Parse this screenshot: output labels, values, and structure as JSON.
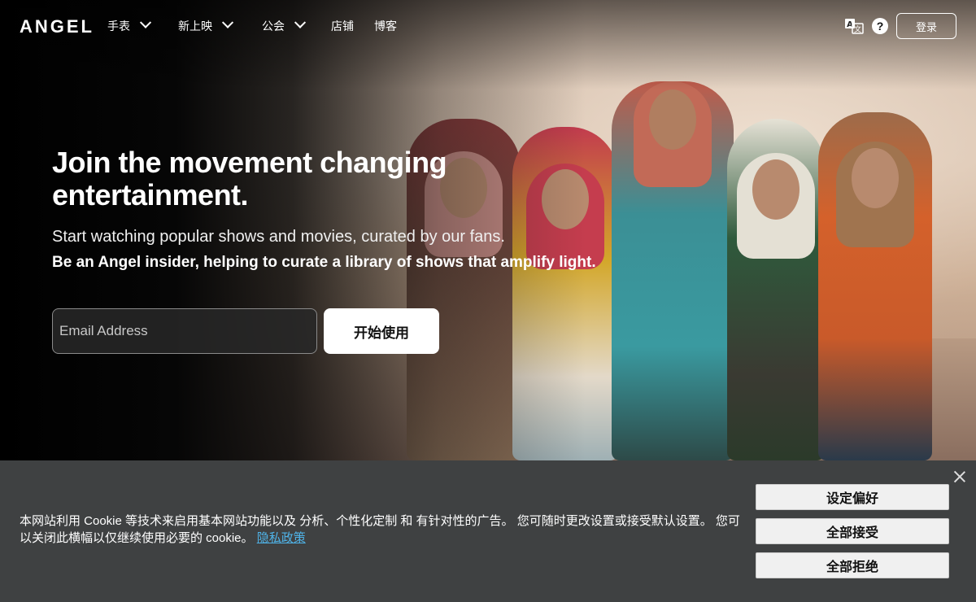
{
  "nav": {
    "logo": "ANGEL",
    "items": [
      {
        "label": "手表",
        "dropdown": true
      },
      {
        "label": "新上映",
        "dropdown": true
      },
      {
        "label": "公会",
        "dropdown": true
      },
      {
        "label": "店铺",
        "dropdown": false
      },
      {
        "label": "博客",
        "dropdown": false
      }
    ],
    "help_glyph": "?",
    "login_label": "登录"
  },
  "hero": {
    "headline": "Join the movement changing entertainment.",
    "subtitle": "Start watching popular shows and movies, curated by our fans.",
    "subtitle_bold": "Be an Angel insider, helping to curate a library of shows that amplify light.",
    "email_placeholder": "Email Address",
    "start_button": "开始使用"
  },
  "cookie": {
    "text": "本网站利用 Cookie 等技术来启用基本网站功能以及 分析、个性化定制 和 有针对性的广告。 您可随时更改设置或接受默认设置。 您可以关闭此横幅以仅继续使用必要的 cookie。",
    "link": "隐私政策",
    "buttons": [
      "设定偏好",
      "全部接受",
      "全部拒绝"
    ]
  },
  "colors": {
    "banner_bg": "#3f4142",
    "link": "#4fb3e8",
    "button_bg": "#f0f0f0"
  },
  "icons": [
    "translate-icon",
    "help-icon",
    "chevron-down-icon",
    "close-icon"
  ]
}
